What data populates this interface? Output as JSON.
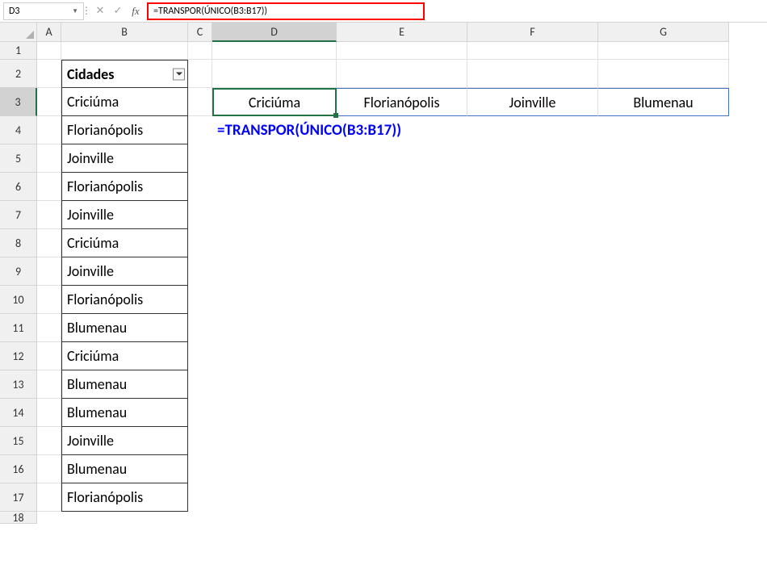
{
  "nameBox": "D3",
  "formulaBar": "=TRANSPOR(ÚNICO(B3:B17))",
  "columnHeaders": [
    "A",
    "B",
    "C",
    "D",
    "E",
    "F",
    "G"
  ],
  "rowHeaders": [
    "1",
    "2",
    "3",
    "4",
    "5",
    "6",
    "7",
    "8",
    "9",
    "10",
    "11",
    "12",
    "13",
    "14",
    "15",
    "16",
    "17",
    "18"
  ],
  "table": {
    "header": "Cidades",
    "data": [
      "Criciúma",
      "Florianópolis",
      "Joinville",
      "Florianópolis",
      "Joinville",
      "Criciúma",
      "Joinville",
      "Florianópolis",
      "Blumenau",
      "Criciúma",
      "Blumenau",
      "Blumenau",
      "Joinville",
      "Blumenau",
      "Florianópolis"
    ]
  },
  "spillResult": {
    "D3": "Criciúma",
    "E3": "Florianópolis",
    "F3": "Joinville",
    "G3": "Blumenau"
  },
  "annotation": "=TRANSPOR(ÚNICO(B3:B17))",
  "activeCell": "D3",
  "activeRow": "3",
  "activeCol": "D"
}
